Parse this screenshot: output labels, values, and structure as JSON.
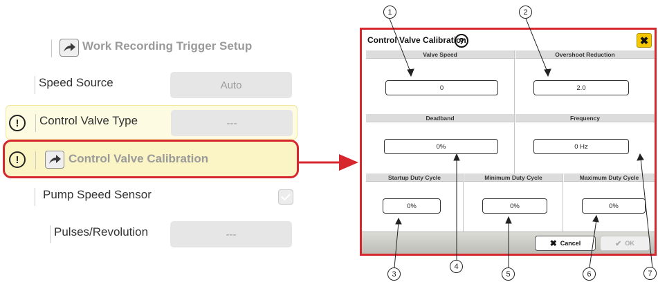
{
  "left_panel": {
    "trigger_setup": "Work Recording Trigger Setup",
    "speed_source": {
      "label": "Speed Source",
      "value": "Auto"
    },
    "control_valve_type": {
      "label": "Control Valve Type",
      "value": "---"
    },
    "control_valve_calibration": {
      "label": "Control Valve Calibration"
    },
    "pump_speed_sensor": {
      "label": "Pump Speed Sensor"
    },
    "pulses_revolution": {
      "label": "Pulses/Revolution",
      "value": "---"
    },
    "warning_symbol": "!"
  },
  "dialog": {
    "title": "Control Valve Calibration",
    "help_symbol": "?",
    "close_symbol": "✖",
    "valve_speed": {
      "label": "Valve Speed",
      "value": "0"
    },
    "overshoot_reduction": {
      "label": "Overshoot Reduction",
      "value": "2.0"
    },
    "deadband": {
      "label": "Deadband",
      "value": "0%"
    },
    "frequency": {
      "label": "Frequency",
      "value": "0 Hz"
    },
    "startup_duty_cycle": {
      "label": "Startup Duty Cycle",
      "value": "0%"
    },
    "minimum_duty_cycle": {
      "label": "Minimum Duty Cycle",
      "value": "0%"
    },
    "maximum_duty_cycle": {
      "label": "Maximum Duty Cycle",
      "value": "0%"
    },
    "cancel_label": "Cancel",
    "cancel_symbol": "✖",
    "ok_label": "OK",
    "ok_symbol": "✔"
  },
  "callouts": [
    "1",
    "2",
    "3",
    "4",
    "5",
    "6",
    "7"
  ],
  "colors": {
    "highlight_border": "#d7272e",
    "highlight_fill": "#fbf4c4",
    "close_button": "#f4c800"
  }
}
